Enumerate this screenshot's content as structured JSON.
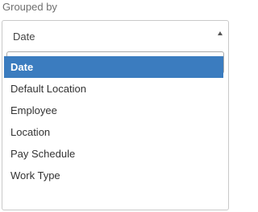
{
  "field": {
    "label": "Grouped by",
    "selected_value": "Date"
  },
  "search": {
    "value": "",
    "placeholder": "",
    "icon": "search-icon"
  },
  "caret_icon": "caret-up-icon",
  "options": [
    {
      "label": "Date",
      "highlighted": true
    },
    {
      "label": "Default Location",
      "highlighted": false
    },
    {
      "label": "Employee",
      "highlighted": false
    },
    {
      "label": "Location",
      "highlighted": false
    },
    {
      "label": "Pay Schedule",
      "highlighted": false
    },
    {
      "label": "Work Type",
      "highlighted": false
    }
  ],
  "colors": {
    "highlight": "#3b7cbf",
    "highlight_text": "#ffffff",
    "border": "#c9c9c9",
    "label": "#6f6f6f"
  }
}
